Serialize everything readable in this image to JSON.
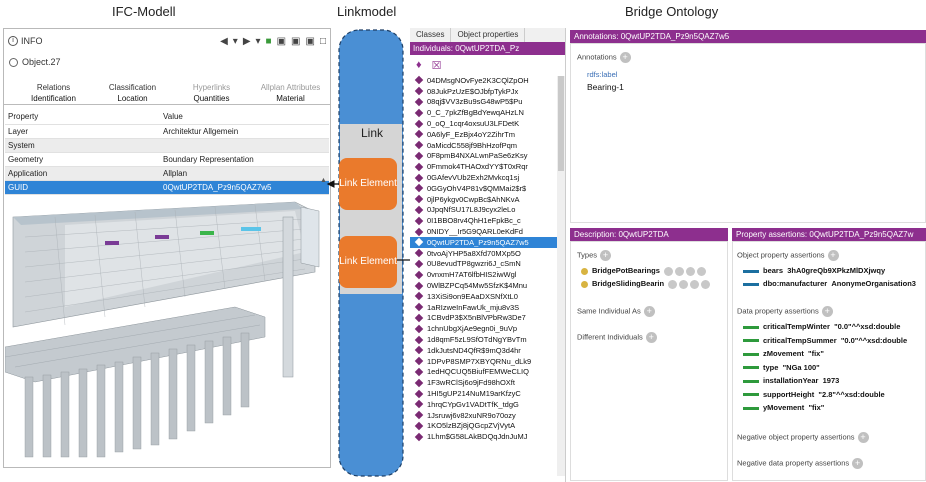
{
  "titles": {
    "ifc": "IFC-Modell",
    "linkmodel": "Linkmodel",
    "ontology": "Bridge Ontology"
  },
  "ifc": {
    "info": "INFO",
    "object": "Object.27",
    "tabs_row1": [
      "Relations",
      "Classification",
      "Hyperlinks",
      "Allplan Attributes"
    ],
    "tabs_row2": [
      "Identification",
      "Location",
      "Quantities",
      "Material"
    ],
    "table_header": {
      "property": "Property",
      "value": "Value"
    },
    "rows": [
      {
        "property": "Layer",
        "value": "Architektur Allgemein"
      },
      {
        "property": "System",
        "value": ""
      },
      {
        "property": "Geometry",
        "value": "Boundary Representation"
      },
      {
        "property": "Application",
        "value": "Allplan"
      },
      {
        "property": "GUID",
        "value": "0QwtUP2TDA_Pz9n5QAZ7w5"
      }
    ]
  },
  "linkmodel": {
    "link_label": "Link",
    "element1": "Link Element",
    "element2": "Link Element"
  },
  "ontology": {
    "tabs": [
      "Classes",
      "Object properties"
    ],
    "individuals_header": "Individuals: 0QwtUP2TDA_Pz",
    "individuals": [
      "04DMsgNOvFye2K3CQlZpOH",
      "08JukPzUzE$OJbfpTykPJx",
      "08qj$VV3zBu9sG48wP5$Pu",
      "0_C_7pkZfBgBdYewqAHzLN",
      "0_oQ_1cqr4oxsuU3LFDetK",
      "0A6lyF_EzBjx4oY2ZihrTm",
      "0aMicdC558jf9BhHzofPqm",
      "0F8pmB4NXALwnPaSe6zKsy",
      "0Fmmok4THAOxdYY$T0xRqr",
      "0GAfevVUb2Exh2Mvkcq1sj",
      "0GGyOhV4P81v$QMMai2$r$",
      "0jlP6ykgv0CwpBc$AhNKvA",
      "0JpqNfSU17L8J9cyx2leLo",
      "0I1BBO8rv4QhH1eFpkBc_c",
      "0NIDY__Ir5G9QARL0eKdFd",
      "0QwtUP2TDA_Pz9n5QAZ7w5",
      "0tvoAjYHP5a8Xfd70MXp5O",
      "0U8evudTP8gwzri6J_cSmN",
      "0vnxmH7AT6lfbHIS2iwWgl",
      "0WlBZPCq54Mw5SfzK$4Mnu",
      "13XiSi9on9EAaDXSNfXtL0",
      "1aRIzweInFawUk_mju8v3S",
      "1CBvdP3$X5nBlVPbRw3De7",
      "1chnUbgXjAe9egn0i_9uVp",
      "1d8qmF5zL9SfOTdNgYBvTm",
      "1dkJutsND4QfR$9mQ3d4hr",
      "1DPvP8SMP7XBYQRNu_dLk9",
      "1edHQCUQ5BiufFEMWeCLIQ",
      "1F3wRClSj6o9jFd98hOXft",
      "1HI5gUP214NuM19arKfzyC",
      "1hrqCYpGv1VADtTfK_tdgG",
      "1Jsruwj6v82xuNR9o70ozy",
      "1KO5lzBZj8jQGcpZVjVytA",
      "1Lhm$G58LAkBDQqJdnJuMJ"
    ],
    "selected_individual": "0QwtUP2TDA_Pz9n5QAZ7w5",
    "annotations_header": "Annotations: 0QwtUP2TDA_Pz9n5QAZ7w5",
    "annotations_label": "Annotations",
    "rdfs_label": "rdfs:label",
    "rdfs_value": "Bearing-1",
    "description_header": "Description: 0QwtUP2TDA",
    "types_label": "Types",
    "types": [
      "BridgePotBearings",
      "BridgeSlidingBearin"
    ],
    "same_individual": "Same Individual As",
    "different_individuals": "Different Individuals",
    "assertions_header": "Property assertions: 0QwtUP2TDA_Pz9n5QAZ7w",
    "object_assertions_label": "Object property assertions",
    "object_assertions": [
      {
        "prop": "bears",
        "value": "3hA0greQb9XPkzMlDXjwqy"
      },
      {
        "prop": "dbo:manufacturer",
        "value": "AnonymeOrganisation3"
      }
    ],
    "data_assertions_label": "Data property assertions",
    "data_assertions": [
      {
        "prop": "criticalTempWinter",
        "value": "\"0.0\"^^xsd:double"
      },
      {
        "prop": "criticalTempSummer",
        "value": "\"0.0\"^^xsd:double"
      },
      {
        "prop": "zMovement",
        "value": "\"fix\""
      },
      {
        "prop": "type",
        "value": "\"NGa 100\""
      },
      {
        "prop": "installationYear",
        "value": "1973"
      },
      {
        "prop": "supportHeight",
        "value": "\"2.8\"^^xsd:double"
      },
      {
        "prop": "yMovement",
        "value": "\"fix\""
      }
    ],
    "neg_object_label": "Negative object property assertions",
    "neg_data_label": "Negative data property assertions"
  },
  "colors": {
    "ontology_header": "#8d2f8e",
    "selection": "#2f84d6",
    "link_element": "#ea7a2c",
    "linkmodel_fill": "#4a8fd4"
  }
}
